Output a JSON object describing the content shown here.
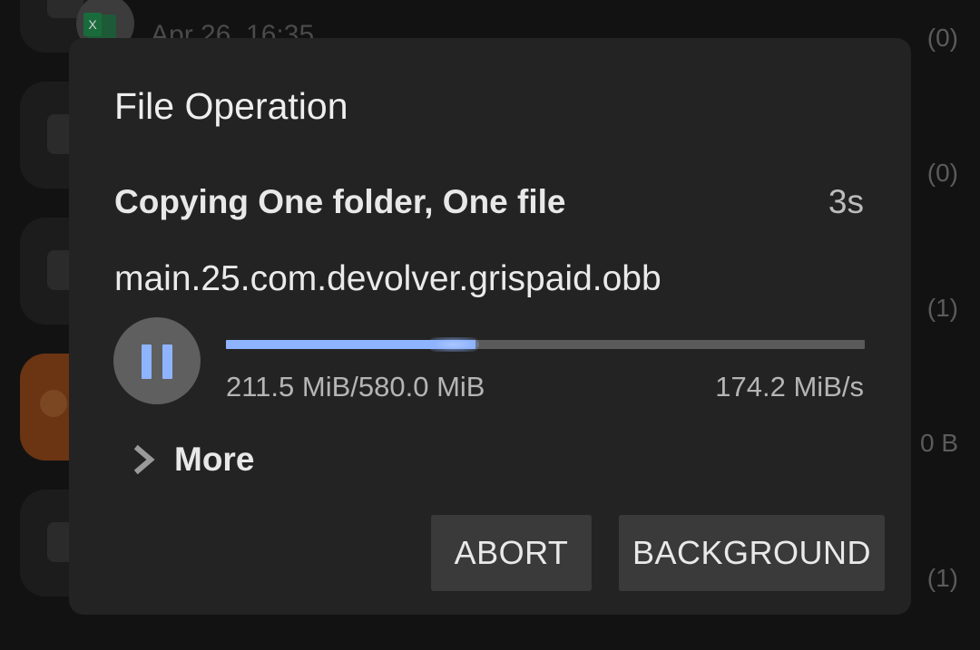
{
  "background": {
    "first_item_date": "Apr 26, 16:35",
    "counts": [
      "(0)",
      "(0)",
      "(1)",
      "0 B",
      "(1)"
    ]
  },
  "dialog": {
    "title": "File Operation",
    "operation_label": "Copying One folder, One file",
    "time_elapsed": "3s",
    "current_file": "main.25.com.devolver.grispaid.obb",
    "progress": {
      "fraction": 0.39,
      "size_text": "211.5 MiB/580.0 MiB",
      "speed_text": "174.2 MiB/s"
    },
    "more_label": "More",
    "buttons": {
      "abort": "ABORT",
      "background": "BACKGROUND"
    }
  },
  "colors": {
    "accent": "#8fb4ff",
    "dialog_bg": "#232323",
    "screen_bg": "#121212",
    "button_bg": "#3a3a3a",
    "orange_item": "#6b3413"
  },
  "icons": {
    "pause": "pause-icon",
    "expand": "chevron-right-icon",
    "spreadsheet": "excel-file-icon"
  }
}
